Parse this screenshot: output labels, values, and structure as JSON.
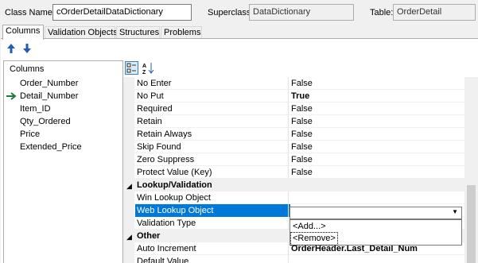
{
  "header": {
    "class_name_label": "Class Name:",
    "class_name_value": "cOrderDetailDataDictionary",
    "superclass_label": "Superclass:",
    "superclass_value": "DataDictionary",
    "table_label": "Table:",
    "table_value": "OrderDetail"
  },
  "tabs": [
    {
      "label": "Columns",
      "active": true
    },
    {
      "label": "Validation Objects",
      "active": false
    },
    {
      "label": "Structures",
      "active": false
    },
    {
      "label": "Problems",
      "active": false
    }
  ],
  "toolbar": {
    "up_icon": "arrow-up-icon",
    "down_icon": "arrow-down-icon"
  },
  "columns_panel": {
    "title": "Columns",
    "items": [
      "Order_Number",
      "Detail_Number",
      "Item_ID",
      "Qty_Ordered",
      "Price",
      "Extended_Price"
    ],
    "current_index": 1
  },
  "property_grid": {
    "rows": [
      {
        "type": "prop",
        "name": "No Enter",
        "value": "False",
        "bold": false
      },
      {
        "type": "prop",
        "name": "No Put",
        "value": "True",
        "bold": true
      },
      {
        "type": "prop",
        "name": "Required",
        "value": "False",
        "bold": false
      },
      {
        "type": "prop",
        "name": "Retain",
        "value": "False",
        "bold": false
      },
      {
        "type": "prop",
        "name": "Retain Always",
        "value": "False",
        "bold": false
      },
      {
        "type": "prop",
        "name": "Skip Found",
        "value": "False",
        "bold": false
      },
      {
        "type": "prop",
        "name": "Zero Suppress",
        "value": "False",
        "bold": false
      },
      {
        "type": "prop",
        "name": "Protect Value (Key)",
        "value": "False",
        "bold": false
      },
      {
        "type": "category",
        "name": "Lookup/Validation"
      },
      {
        "type": "prop",
        "name": "Win Lookup Object",
        "value": "",
        "bold": false
      },
      {
        "type": "prop",
        "name": "Web Lookup Object",
        "value": "",
        "bold": false,
        "selected": true
      },
      {
        "type": "prop",
        "name": "Validation Type",
        "value": "",
        "bold": false
      },
      {
        "type": "category",
        "name": "Other"
      },
      {
        "type": "prop",
        "name": "Auto Increment",
        "value": "OrderHeader.Last_Detail_Num",
        "bold": true
      },
      {
        "type": "prop",
        "name": "Default Value",
        "value": "",
        "bold": false
      }
    ]
  },
  "dropdown": {
    "options": [
      "<Add...>",
      "<Remove>"
    ],
    "focused_index": 1
  },
  "colors": {
    "selection": "#0078d7",
    "arrow": "#1e7a3c"
  }
}
